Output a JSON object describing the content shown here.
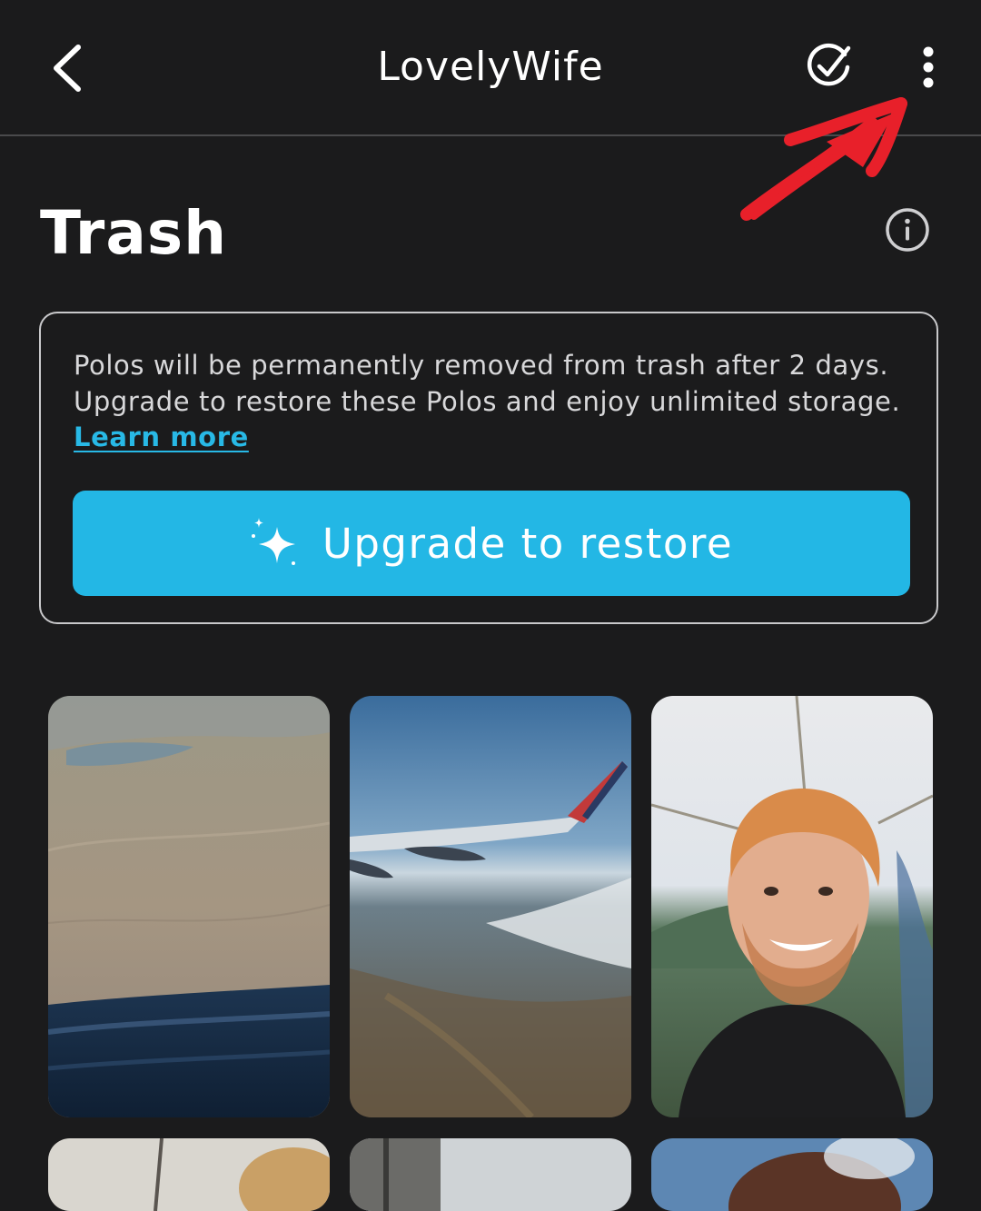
{
  "header": {
    "title": "LovelyWife",
    "back_icon": "chevron-left-icon",
    "select_icon": "check-circle-icon",
    "more_icon": "more-vertical-icon"
  },
  "page": {
    "title": "Trash",
    "info_icon": "info-icon"
  },
  "notice": {
    "text": "Polos will be permanently removed from trash after 2 days. Upgrade to restore these Polos and enjoy unlimited storage.",
    "link_label": "Learn more",
    "button_label": "Upgrade to restore",
    "button_icon": "sparkle-icon"
  },
  "colors": {
    "background": "#1b1b1c",
    "accent": "#23b7e5",
    "link": "#28b9e6",
    "annotation": "#e8202a"
  },
  "photos": [
    {
      "name": "aerial-desert-from-plane-window"
    },
    {
      "name": "airplane-wing-over-mountains"
    },
    {
      "name": "smiling-man-selfie"
    },
    {
      "name": "partial-photo-1"
    },
    {
      "name": "partial-photo-2"
    },
    {
      "name": "partial-photo-3"
    }
  ]
}
